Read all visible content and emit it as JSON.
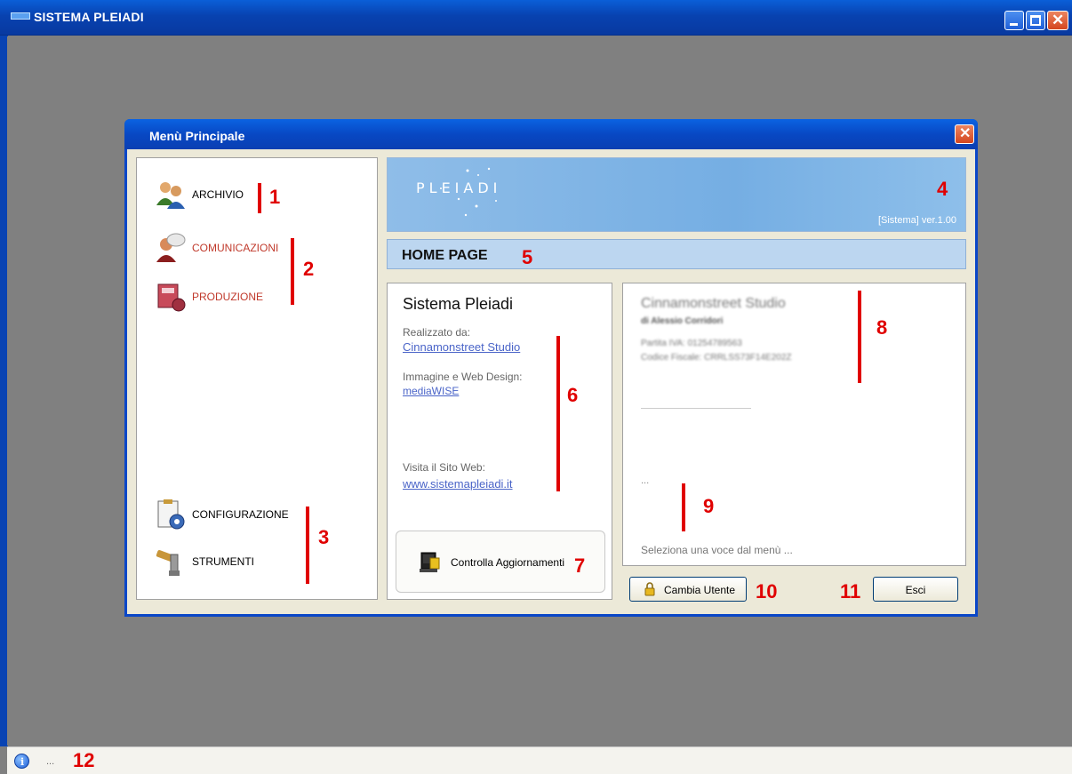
{
  "window": {
    "title": "SISTEMA PLEIADI"
  },
  "dialog": {
    "title": "Menù Principale"
  },
  "menu": {
    "items": [
      {
        "label": "ARCHIVIO",
        "icon": "users-icon"
      },
      {
        "label": "COMUNICAZIONI",
        "icon": "chat-person-icon"
      },
      {
        "label": "PRODUZIONE",
        "icon": "machine-icon"
      },
      {
        "label": "CONFIGURAZIONE",
        "icon": "clipboard-gear-icon"
      },
      {
        "label": "STRUMENTI",
        "icon": "tools-icon"
      }
    ]
  },
  "banner": {
    "logo": "PLEIADI",
    "version": "[Sistema]  ver.1.00"
  },
  "home": {
    "title": "HOME PAGE"
  },
  "info": {
    "heading": "Sistema Pleiadi",
    "made_by_label": "Realizzato da:",
    "made_by_link": "Cinnamonstreet Studio",
    "design_label": "Immagine e Web Design:",
    "design_link": "mediaWISE",
    "site_label": "Visita il Sito Web:",
    "site_link": "www.sistemapleiadi.it",
    "update_button": "Controlla Aggiornamenti"
  },
  "detail": {
    "company": "Cinnamonstreet Studio",
    "owner": "di Alessio Corridori",
    "vat": "Partita IVA: 01254789563",
    "tax_code": "Codice Fiscale: CRRLSS73F14E202Z",
    "dots": "...",
    "select_hint": "Seleziona una voce dal menù ..."
  },
  "buttons": {
    "change_user": "Cambia Utente",
    "exit": "Esci"
  },
  "status": {
    "text": "..."
  },
  "annotations": [
    "1",
    "2",
    "3",
    "4",
    "5",
    "6",
    "7",
    "8",
    "9",
    "10",
    "11",
    "12"
  ],
  "colors": {
    "titlebar": "#0842b0",
    "accent_red": "#e00000",
    "link": "#4a64c8",
    "banner": "#75aee3"
  }
}
